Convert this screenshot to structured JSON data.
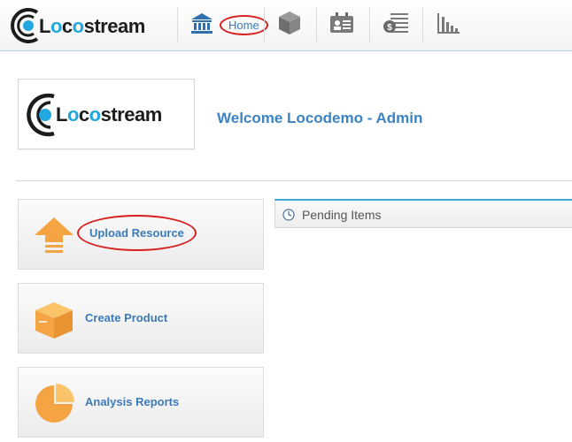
{
  "app": {
    "brand": "Locostream",
    "brand_parts": [
      "L",
      "o",
      "c",
      "o",
      "stream"
    ]
  },
  "nav": {
    "items": [
      {
        "name": "home",
        "label": "Home",
        "icon": "bank-icon"
      },
      {
        "name": "products",
        "icon": "box-icon"
      },
      {
        "name": "contacts",
        "icon": "id-card-icon"
      },
      {
        "name": "billing",
        "icon": "money-list-icon"
      },
      {
        "name": "reports",
        "icon": "bar-chart-icon"
      }
    ]
  },
  "header": {
    "welcome_text": "Welcome Locodemo - Admin"
  },
  "tiles": [
    {
      "label": "Upload Resource",
      "icon": "upload-arrow-icon"
    },
    {
      "label": "Create Product",
      "icon": "box-icon"
    },
    {
      "label": "Analysis Reports",
      "icon": "pie-chart-icon"
    }
  ],
  "pending": {
    "title": "Pending Items",
    "icon": "clock-icon"
  },
  "colors": {
    "accent_blue": "#3a83c4",
    "logo_cyan": "#22a7e0",
    "tile_orange": "#f5a443",
    "annotation_red": "#d61f1f"
  }
}
